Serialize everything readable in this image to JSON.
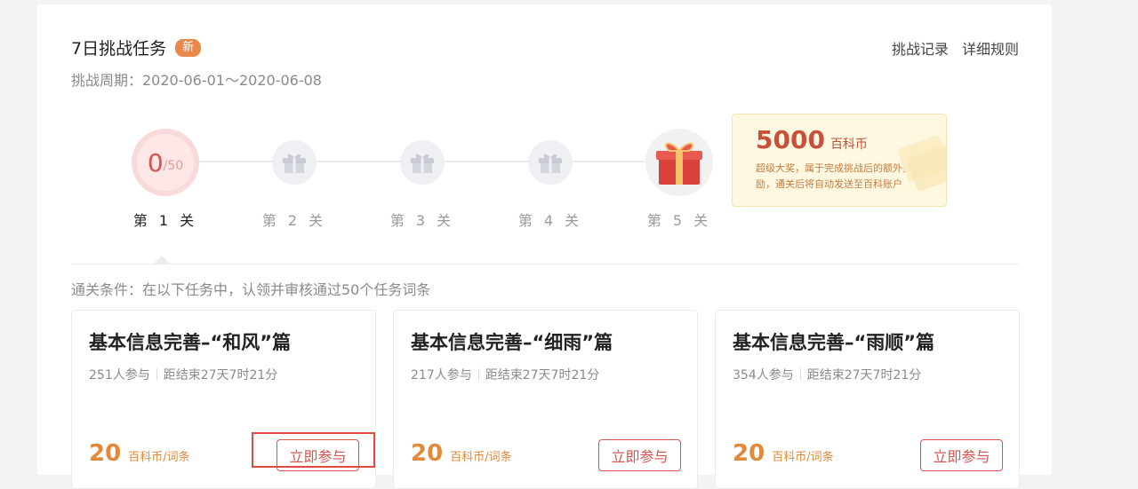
{
  "header": {
    "title": "7日挑战任务",
    "badge": "新",
    "period": "挑战周期：2020-06-01～2020-06-08",
    "links": [
      "挑战记录",
      "详细规则"
    ]
  },
  "progress": {
    "current": "0",
    "total": "/50"
  },
  "stages": [
    {
      "label": "第 1 关",
      "active": true,
      "icon": "progress-ring"
    },
    {
      "label": "第 2 关",
      "active": false,
      "icon": "gift-icon"
    },
    {
      "label": "第 3 关",
      "active": false,
      "icon": "gift-icon"
    },
    {
      "label": "第 4 关",
      "active": false,
      "icon": "gift-icon"
    },
    {
      "label": "第 5 关",
      "active": false,
      "icon": "big-gift-icon"
    }
  ],
  "prize": {
    "amount": "5000",
    "unit": "百科币",
    "description": "超级大奖，属于完成挑战后的额外奖励，通关后将自动发送至百科账户"
  },
  "condition": "通关条件：在以下任务中，认领并审核通过50个任务词条",
  "cards": [
    {
      "title": "基本信息完善–“和风”篇",
      "participants": "251人参与",
      "deadline": "距结束27天7时21分",
      "reward": "20",
      "reward_unit": "百科币/词条",
      "button": "立即参与"
    },
    {
      "title": "基本信息完善–“细雨”篇",
      "participants": "217人参与",
      "deadline": "距结束27天7时21分",
      "reward": "20",
      "reward_unit": "百科币/词条",
      "button": "立即参与"
    },
    {
      "title": "基本信息完善–“雨顺”篇",
      "participants": "354人参与",
      "deadline": "距结束27天7时21分",
      "reward": "20",
      "reward_unit": "百科币/词条",
      "button": "立即参与"
    }
  ],
  "colors": {
    "accent_red": "#d9534f",
    "badge_orange": "#e8884a",
    "prize_bg": "#fff8e1",
    "reward_orange": "#e28a3c"
  }
}
